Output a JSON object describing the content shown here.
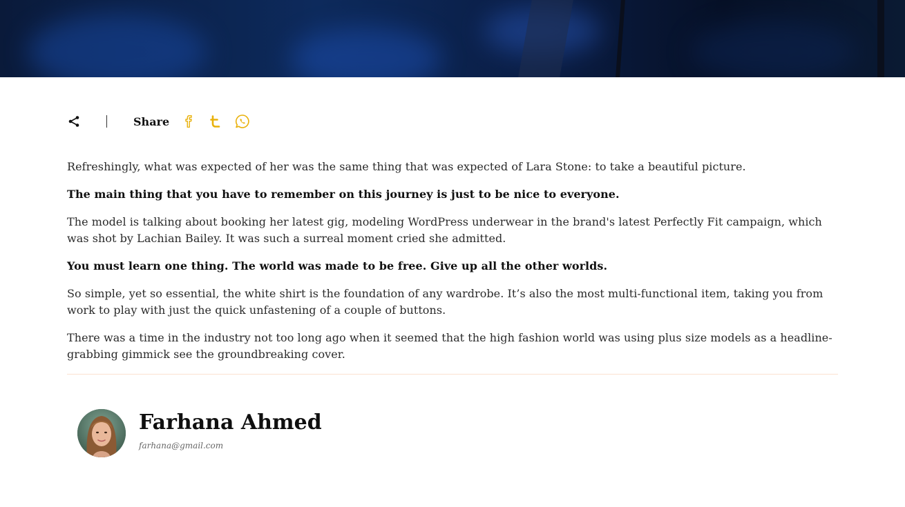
{
  "hero": {
    "image_alt": "hero-image"
  },
  "share": {
    "label": "Share",
    "icon": "share-icon",
    "networks": [
      {
        "name": "facebook",
        "icon": "facebook-icon",
        "color": "#e9b10b"
      },
      {
        "name": "tumblr",
        "icon": "tumblr-icon",
        "color": "#e9b10b"
      },
      {
        "name": "whatsapp",
        "icon": "whatsapp-icon",
        "color": "#e9b10b"
      }
    ]
  },
  "article": {
    "paragraphs": [
      {
        "text": "Refreshingly, what was expected of her was the same thing that was expected of Lara Stone: to take a beautiful picture.",
        "bold": false
      },
      {
        "text": "The main thing that you have to remember on this journey is just to be nice to everyone.",
        "bold": true
      },
      {
        "text": "The model is talking about booking her latest gig, modeling WordPress underwear in the brand's latest Perfectly Fit campaign, which was shot by Lachian Bailey. It was such a surreal moment cried she admitted.",
        "bold": false
      },
      {
        "text": "You must learn one thing. The world was made to be free. Give up all the other worlds.",
        "bold": true
      },
      {
        "text": "So simple, yet so essential, the white shirt is the foundation of any wardrobe. It’s also the most multi-functional item, taking you from work to play with just the quick unfastening of a couple of buttons.",
        "bold": false
      },
      {
        "text": "There was a time in the industry not too long ago when it seemed that the high fashion world was using plus size models as a headline-grabbing gimmick see the groundbreaking cover.",
        "bold": false
      }
    ]
  },
  "author": {
    "name": "Farhana Ahmed",
    "email": "farhana@gmail.com"
  },
  "colors": {
    "accent": "#e9b10b",
    "divider": "#fbe1d0"
  }
}
